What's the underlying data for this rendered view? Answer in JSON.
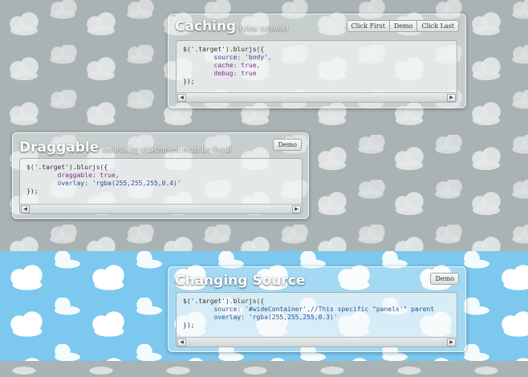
{
  "panels": {
    "caching": {
      "title": "Caching",
      "subtitle": "(view console)",
      "buttons": [
        "Click First",
        "Demo",
        "Click Last"
      ],
      "code": [
        "$('.target').blurjs({",
        "        source: 'body',",
        "        cache: true,",
        "        debug: true",
        "});"
      ]
    },
    "draggable": {
      "title": "Draggable",
      "subtitle": "(source bg attachment must be fixed)",
      "buttons": [
        "Demo"
      ],
      "code": [
        "$('.target').blurjs({",
        "        draggable: true,",
        "        overlay: 'rgba(255,255,255,0.4)'",
        "});"
      ]
    },
    "changing_source": {
      "title": "Changing Source",
      "buttons": [
        "Demo"
      ],
      "code": [
        "$('.target').blurjs({",
        "        source: '#wideContainer',//This specific \"panels'\" parent",
        "        overlay: 'rgba(255,255,255,0.3)'",
        "});"
      ]
    }
  },
  "scroll": {
    "left_arrow": "◀",
    "right_arrow": "▶"
  },
  "colors": {
    "gray_background": "#a9b3b3",
    "blue_background": "#7cc8ef",
    "keyword": "#7d2f8a",
    "string": "#2a4e95"
  }
}
